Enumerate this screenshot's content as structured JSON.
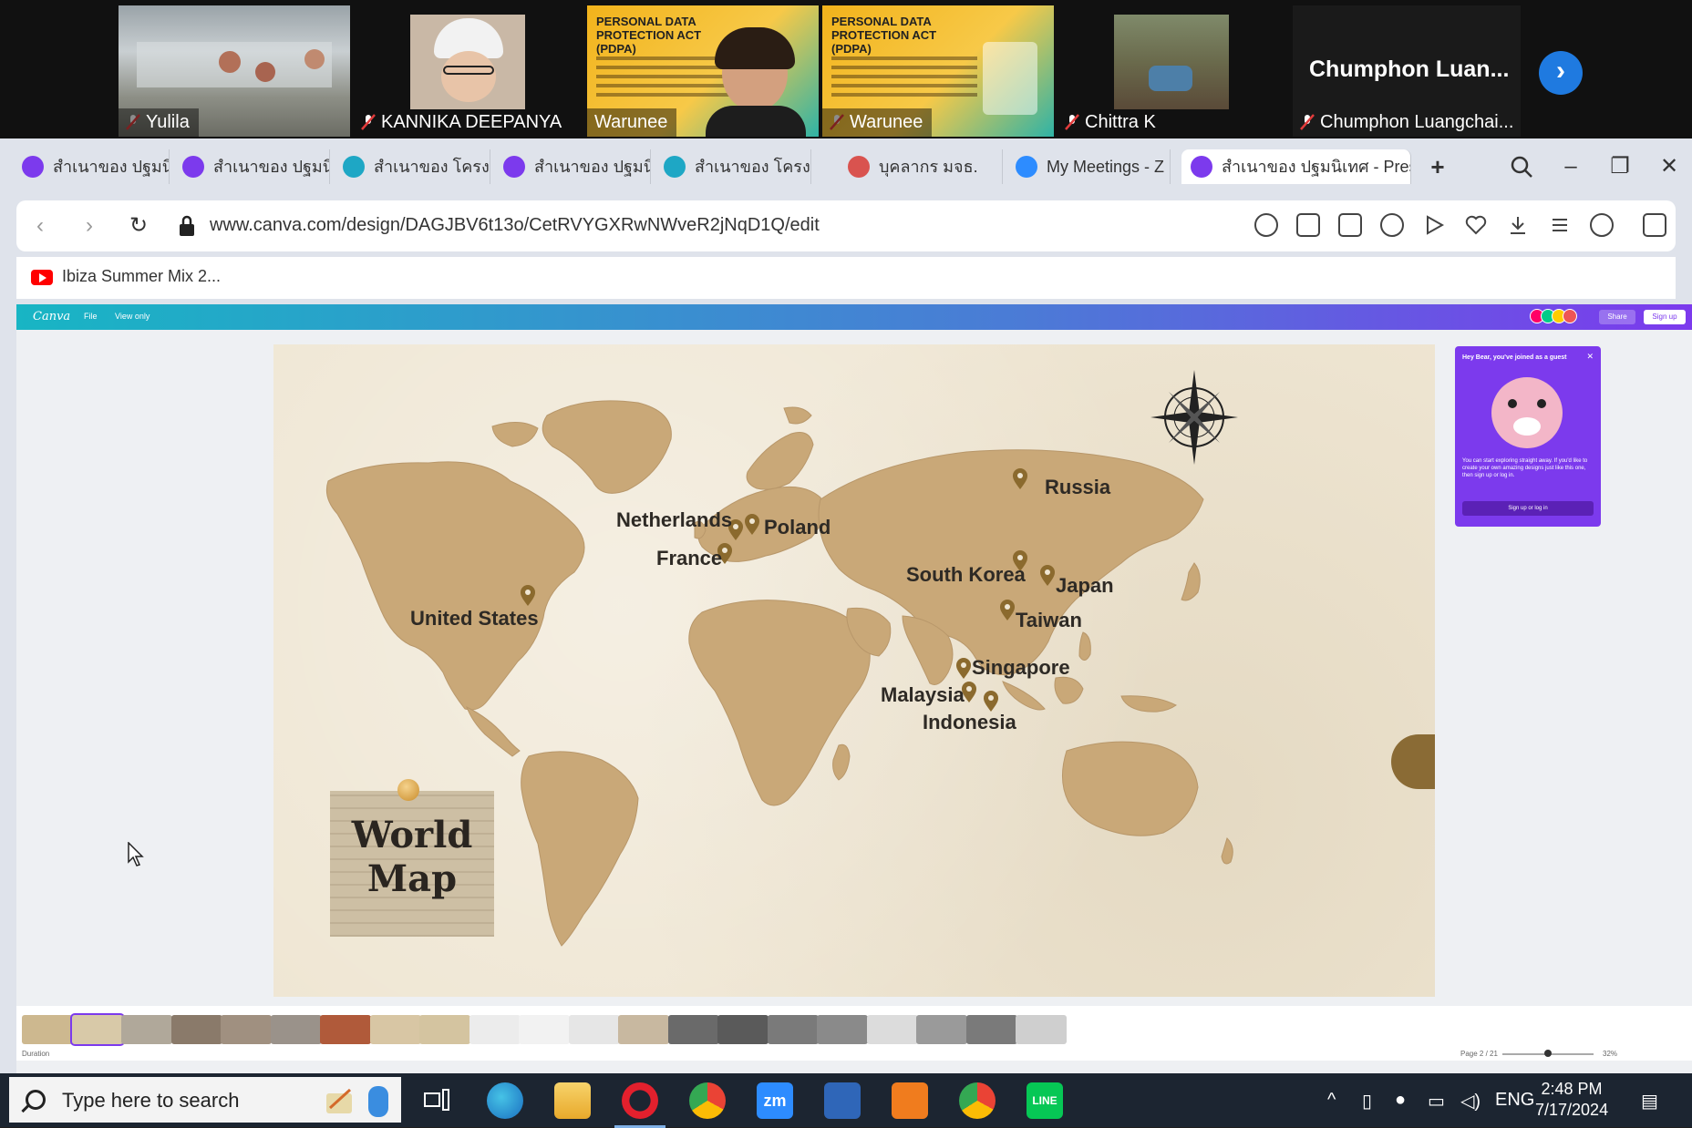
{
  "zoom": {
    "participants": [
      {
        "name": "Yulila",
        "active": true
      },
      {
        "name": "KANNIKA DEEPANYA"
      },
      {
        "name": "Warunee",
        "slide_title": "PERSONAL DATA PROTECTION ACT (PDPA)"
      },
      {
        "name": "Warunee",
        "slide_title": "PERSONAL DATA PROTECTION ACT (PDPA)"
      },
      {
        "name": "Chittra K"
      },
      {
        "name": "Chumphon Luangchai..."
      }
    ],
    "big_name": "Chumphon  Luan..."
  },
  "browser": {
    "tabs": [
      {
        "label": "สำเนาของ ปฐมนิเทศ",
        "color": "#7c3aed"
      },
      {
        "label": "สำเนาของ ปฐมนิเทศ",
        "color": "#7c3aed"
      },
      {
        "label": "สำเนาของ โครงการ",
        "color": "#1ea7c5"
      },
      {
        "label": "สำเนาของ ปฐมนิเทศ",
        "color": "#7c3aed"
      },
      {
        "label": "สำเนาของ โครงการ",
        "color": "#1ea7c5"
      },
      {
        "label": "บุคลากร มจธ.",
        "color": "#d9534f"
      },
      {
        "label": "My Meetings - Z",
        "color": "#2d8cff"
      },
      {
        "label": "สำเนาของ ปฐมนิเทศ - Preser",
        "color": "#7c3aed",
        "active": true
      }
    ],
    "url": "www.canva.com/design/DAGJBV6t13o/CetRVYGXRwNWveR2jNqD1Q/edit",
    "bookmark": "Ibiza Summer Mix 2..."
  },
  "canva": {
    "logo": "Canva",
    "menu": [
      "File",
      "View only"
    ],
    "share": "Share",
    "signup": "Sign up",
    "guest_popup": {
      "title": "Hey Bear, you've joined as a guest",
      "body": "You can start exploring straight away. If you'd like to create your own amazing designs just like this one, then sign up or log in.",
      "button": "Sign up or log in"
    },
    "slide": {
      "card_title_line1": "World",
      "card_title_line2": "Map",
      "locations": [
        {
          "name": "United States"
        },
        {
          "name": "Netherlands"
        },
        {
          "name": "Poland"
        },
        {
          "name": "France"
        },
        {
          "name": "Russia"
        },
        {
          "name": "South Korea"
        },
        {
          "name": "Japan"
        },
        {
          "name": "Taiwan"
        },
        {
          "name": "Singapore"
        },
        {
          "name": "Malaysia"
        },
        {
          "name": "Indonesia"
        }
      ],
      "colors": {
        "land": "#c9a878",
        "pin": "#8b6a2e",
        "paper": "#efe6d3"
      }
    },
    "footer": {
      "duration": "Duration",
      "page": "Page 2 / 21",
      "zoom": "32%"
    }
  },
  "taskbar": {
    "search_placeholder": "Type here to search",
    "language": "ENG",
    "time": "2:48 PM",
    "date": "7/17/2024"
  }
}
